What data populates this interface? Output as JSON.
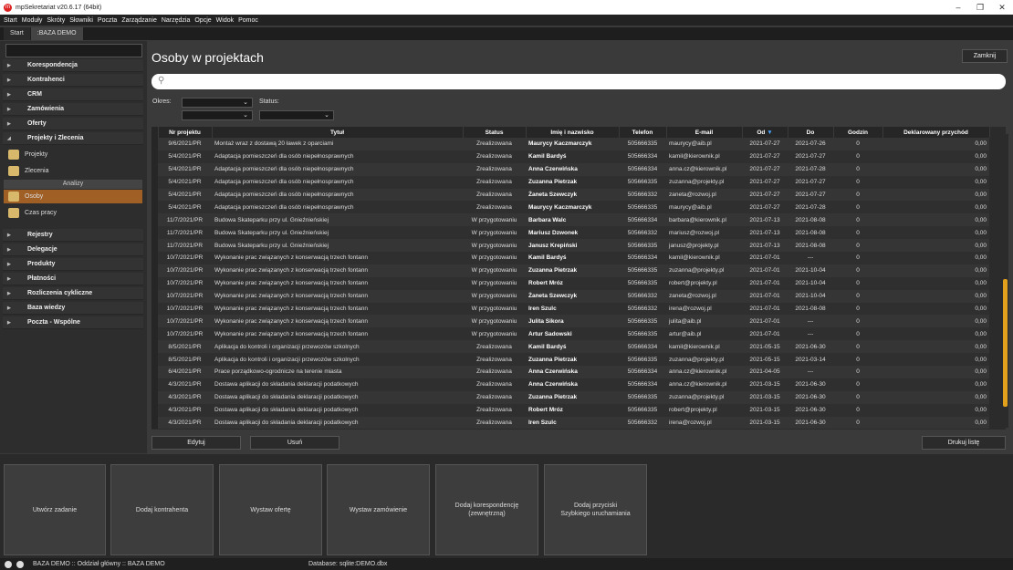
{
  "window": {
    "title": "mpSekretariat v20.6.17 (64bit)",
    "minimize": "–",
    "maximize": "❐",
    "close": "✕"
  },
  "menu": [
    "Start",
    "Moduły",
    "Skróty",
    "Słowniki",
    "Poczta",
    "Zarządzanie",
    "Narzędzia",
    "Opcje",
    "Widok",
    "Pomoc"
  ],
  "tabs": [
    "Start",
    ":BAZA DEMO"
  ],
  "sidebar": {
    "groups_top": [
      "Korespondencja",
      "Kontrahenci",
      "CRM",
      "Zamówienia",
      "Oferty",
      "Projekty i Zlecenia"
    ],
    "sub_projects": [
      "Projekty",
      "Zlecenia"
    ],
    "analysis_header": "Analizy",
    "sub_analysis": [
      "Osoby",
      "Czas pracy"
    ],
    "groups_bottom": [
      "Rejestry",
      "Delegacje",
      "Produkty",
      "Płatności",
      "Rozliczenia cykliczne",
      "Baza wiedzy",
      "Poczta - Wspólne"
    ]
  },
  "page": {
    "title": "Osoby w projektach",
    "close_label": "Zamknij",
    "search_icon": "search-icon"
  },
  "filters": {
    "period_label": "Okres:",
    "status_label": "Status:"
  },
  "table": {
    "columns": [
      "Nr projektu",
      "Tytuł",
      "Status",
      "Imię i nazwisko",
      "Telefon",
      "E-mail",
      "Od",
      "Do",
      "Godzin",
      "Deklarowany przychód"
    ],
    "sort_indicator": "▼",
    "rows": [
      [
        "9/6/2021/PR",
        "Montaż wraz z dostawą 20 ławek z oparciami",
        "Zrealizowana",
        "Maurycy Kaczmarczyk",
        "505666335",
        "maurycy@aib.pl",
        "2021-07-27",
        "2021-07-26",
        "0",
        "0,00"
      ],
      [
        "5/4/2021/PR",
        "Adaptacja pomieszczeń dla osób niepełnosprawnych",
        "Zrealizowana",
        "Kamil Bardyś",
        "505666334",
        "kamil@kierownik.pl",
        "2021-07-27",
        "2021-07-27",
        "0",
        "0,00"
      ],
      [
        "5/4/2021/PR",
        "Adaptacja pomieszczeń dla osób niepełnosprawnych",
        "Zrealizowana",
        "Anna Czerwińska",
        "505666334",
        "anna.cz@kierownik.pl",
        "2021-07-27",
        "2021-07-28",
        "0",
        "0,00"
      ],
      [
        "5/4/2021/PR",
        "Adaptacja pomieszczeń dla osób niepełnosprawnych",
        "Zrealizowana",
        "Zuzanna Pietrzak",
        "505666335",
        "zuzanna@projekty.pl",
        "2021-07-27",
        "2021-07-27",
        "0",
        "0,00"
      ],
      [
        "5/4/2021/PR",
        "Adaptacja pomieszczeń dla osób niepełnosprawnych",
        "Zrealizowana",
        "Żaneta Szewczyk",
        "505666332",
        "zaneta@rozwoj.pl",
        "2021-07-27",
        "2021-07-27",
        "0",
        "0,00"
      ],
      [
        "5/4/2021/PR",
        "Adaptacja pomieszczeń dla osób niepełnosprawnych",
        "Zrealizowana",
        "Maurycy Kaczmarczyk",
        "505666335",
        "maurycy@aib.pl",
        "2021-07-27",
        "2021-07-28",
        "0",
        "0,00"
      ],
      [
        "11/7/2021/PR",
        "Budowa Skateparku przy ul. Gnieźnieńskiej",
        "W przygotowaniu",
        "Barbara Walc",
        "505666334",
        "barbara@kierownik.pl",
        "2021-07-13",
        "2021-08-08",
        "0",
        "0,00"
      ],
      [
        "11/7/2021/PR",
        "Budowa Skateparku przy ul. Gnieźnieńskiej",
        "W przygotowaniu",
        "Mariusz Dzwonek",
        "505666332",
        "mariusz@rozwoj.pl",
        "2021-07-13",
        "2021-08-08",
        "0",
        "0,00"
      ],
      [
        "11/7/2021/PR",
        "Budowa Skateparku przy ul. Gnieźnieńskiej",
        "W przygotowaniu",
        "Janusz Krepiński",
        "505666335",
        "janusz@projekty.pl",
        "2021-07-13",
        "2021-08-08",
        "0",
        "0,00"
      ],
      [
        "10/7/2021/PR",
        "Wykonanie prac związanych z konserwacją trzech fontann",
        "W przygotowaniu",
        "Kamil Bardyś",
        "505666334",
        "kamil@kierownik.pl",
        "2021-07-01",
        "---",
        "0",
        "0,00"
      ],
      [
        "10/7/2021/PR",
        "Wykonanie prac związanych z konserwacją trzech fontann",
        "W przygotowaniu",
        "Zuzanna Pietrzak",
        "505666335",
        "zuzanna@projekty.pl",
        "2021-07-01",
        "2021-10-04",
        "0",
        "0,00"
      ],
      [
        "10/7/2021/PR",
        "Wykonanie prac związanych z konserwacją trzech fontann",
        "W przygotowaniu",
        "Robert Mróz",
        "505666335",
        "robert@projekty.pl",
        "2021-07-01",
        "2021-10-04",
        "0",
        "0,00"
      ],
      [
        "10/7/2021/PR",
        "Wykonanie prac związanych z konserwacją trzech fontann",
        "W przygotowaniu",
        "Żaneta Szewczyk",
        "505666332",
        "zaneta@rozwoj.pl",
        "2021-07-01",
        "2021-10-04",
        "0",
        "0,00"
      ],
      [
        "10/7/2021/PR",
        "Wykonanie prac związanych z konserwacją trzech fontann",
        "W przygotowaniu",
        "Iren Szulc",
        "505666332",
        "irena@rozwoj.pl",
        "2021-07-01",
        "2021-08-08",
        "0",
        "0,00"
      ],
      [
        "10/7/2021/PR",
        "Wykonanie prac związanych z konserwacją trzech fontann",
        "W przygotowaniu",
        "Julita Sikora",
        "505666335",
        "julita@aib.pl",
        "2021-07-01",
        "---",
        "0",
        "0,00"
      ],
      [
        "10/7/2021/PR",
        "Wykonanie prac związanych z konserwacją trzech fontann",
        "W przygotowaniu",
        "Artur Sadowski",
        "505666335",
        "artur@aib.pl",
        "2021-07-01",
        "---",
        "0",
        "0,00"
      ],
      [
        "8/5/2021/PR",
        "Aplikacja do kontroli i organizacji przewozów szkolnych",
        "Zrealizowana",
        "Kamil Bardyś",
        "505666334",
        "kamil@kierownik.pl",
        "2021-05-15",
        "2021-06-30",
        "0",
        "0,00"
      ],
      [
        "8/5/2021/PR",
        "Aplikacja do kontroli i organizacji przewozów szkolnych",
        "Zrealizowana",
        "Zuzanna Pietrzak",
        "505666335",
        "zuzanna@projekty.pl",
        "2021-05-15",
        "2021-03-14",
        "0",
        "0,00"
      ],
      [
        "6/4/2021/PR",
        "Prace porządkowo-ogrodnicze na terenie miasta",
        "Zrealizowana",
        "Anna Czerwińska",
        "505666334",
        "anna.cz@kierownik.pl",
        "2021-04-05",
        "---",
        "0",
        "0,00"
      ],
      [
        "4/3/2021/PR",
        "Dostawa aplikacji do składania deklaracji podatkowych",
        "Zrealizowana",
        "Anna Czerwińska",
        "505666334",
        "anna.cz@kierownik.pl",
        "2021-03-15",
        "2021-06-30",
        "0",
        "0,00"
      ],
      [
        "4/3/2021/PR",
        "Dostawa aplikacji do składania deklaracji podatkowych",
        "Zrealizowana",
        "Zuzanna Pietrzak",
        "505666335",
        "zuzanna@projekty.pl",
        "2021-03-15",
        "2021-06-30",
        "0",
        "0,00"
      ],
      [
        "4/3/2021/PR",
        "Dostawa aplikacji do składania deklaracji podatkowych",
        "Zrealizowana",
        "Robert Mróz",
        "505666335",
        "robert@projekty.pl",
        "2021-03-15",
        "2021-06-30",
        "0",
        "0,00"
      ],
      [
        "4/3/2021/PR",
        "Dostawa aplikacji do składania deklaracji podatkowych",
        "Zrealizowana",
        "Iren Szulc",
        "505666332",
        "irena@rozwoj.pl",
        "2021-03-15",
        "2021-06-30",
        "0",
        "0,00"
      ]
    ]
  },
  "actions": {
    "edit": "Edytuj",
    "delete": "Usuń",
    "print": "Drukuj listę"
  },
  "quick": [
    "Utwórz zadanie",
    "Dodaj kontrahenta",
    "Wystaw ofertę",
    "Wystaw zamówienie",
    "Dodaj korespondencję\n(zewnętrzną)",
    "Dodaj przyciski\nSzybkiego uruchamiania"
  ],
  "status": {
    "left": "BAZA DEMO :: Oddział główny :: BAZA DEMO",
    "db": "Database: sqlite:DEMO.dbx"
  },
  "colors": {
    "accent": "#e3a01c",
    "active_nav": "#a05f25"
  }
}
